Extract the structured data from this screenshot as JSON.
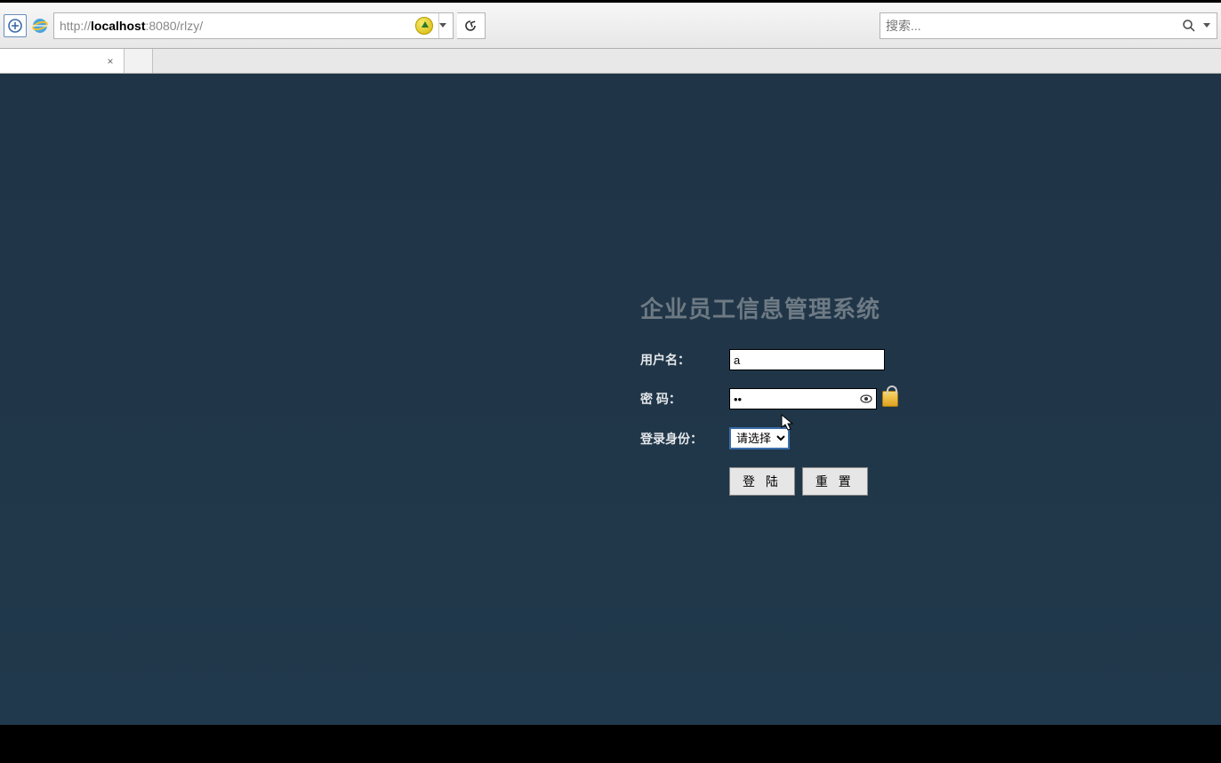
{
  "chrome": {
    "url_prefix": "http://",
    "url_host": "localhost",
    "url_port_path": ":8080/rlzy/",
    "search_placeholder": "搜索..."
  },
  "tab": {
    "title": "",
    "close_glyph": "×"
  },
  "login": {
    "title": "企业员工信息管理系统",
    "username_label": "用户名：",
    "username_value": "a",
    "password_label": "密 码：",
    "password_value": "aa",
    "role_label": "登录身份：",
    "role_placeholder": "请选择",
    "submit_label": "登 陆",
    "reset_label": "重 置"
  }
}
